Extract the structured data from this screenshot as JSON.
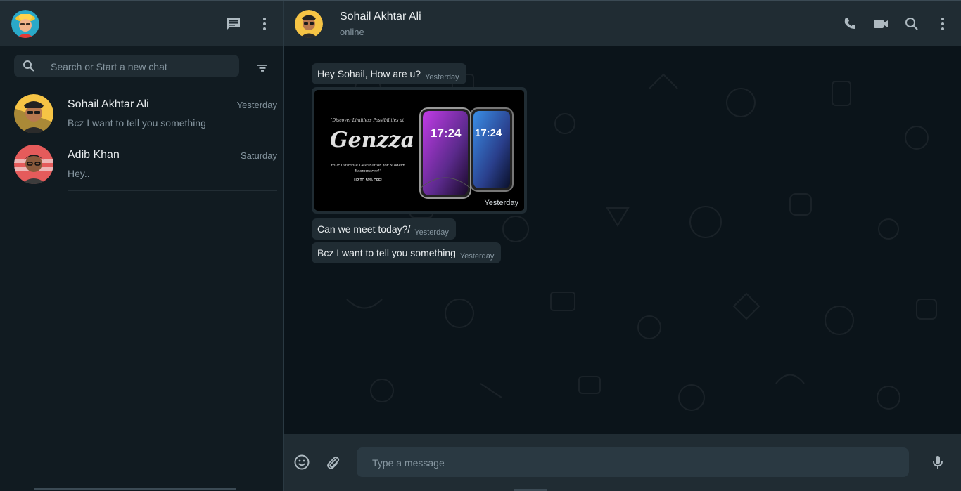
{
  "sidebar": {
    "search_placeholder": "Search or Start a new chat",
    "chats": [
      {
        "name": "Sohail Akhtar Ali",
        "time": "Yesterday",
        "preview": "Bcz I want to tell you something"
      },
      {
        "name": "Adib Khan",
        "time": "Saturday",
        "preview": "Hey.."
      }
    ]
  },
  "conversation": {
    "contact_name": "Sohail Akhtar Ali",
    "status": "online",
    "messages": [
      {
        "text": "Hey Sohail, How are u?",
        "time": "Yesterday"
      },
      {
        "type": "image",
        "time": "Yesterday",
        "image_text": {
          "tagline": "\"Discover Limitless Possibilities at",
          "brand": "Genzza",
          "subline": "Your Ultimate Destination for Modern Ecommerce!\"",
          "offer": "UP TO 50% OFF!",
          "clock": "17:24"
        }
      },
      {
        "text": "Can we meet today?/",
        "time": "Yesterday"
      },
      {
        "text": "Bcz I want to tell you something",
        "time": "Yesterday"
      }
    ],
    "input_placeholder": "Type a message"
  },
  "colors": {
    "app_bg": "#111b21",
    "panel_header": "#202c33",
    "chat_bg": "#0b141a",
    "bubble": "#202c33",
    "secondary_text": "#8696a0",
    "primary_text": "#e9edef",
    "icon": "#aebac1"
  },
  "icons": [
    "new-chat-icon",
    "menu-icon",
    "search-icon",
    "filter-icon",
    "phone-icon",
    "video-call-icon",
    "emoji-icon",
    "attach-icon",
    "mic-icon"
  ]
}
